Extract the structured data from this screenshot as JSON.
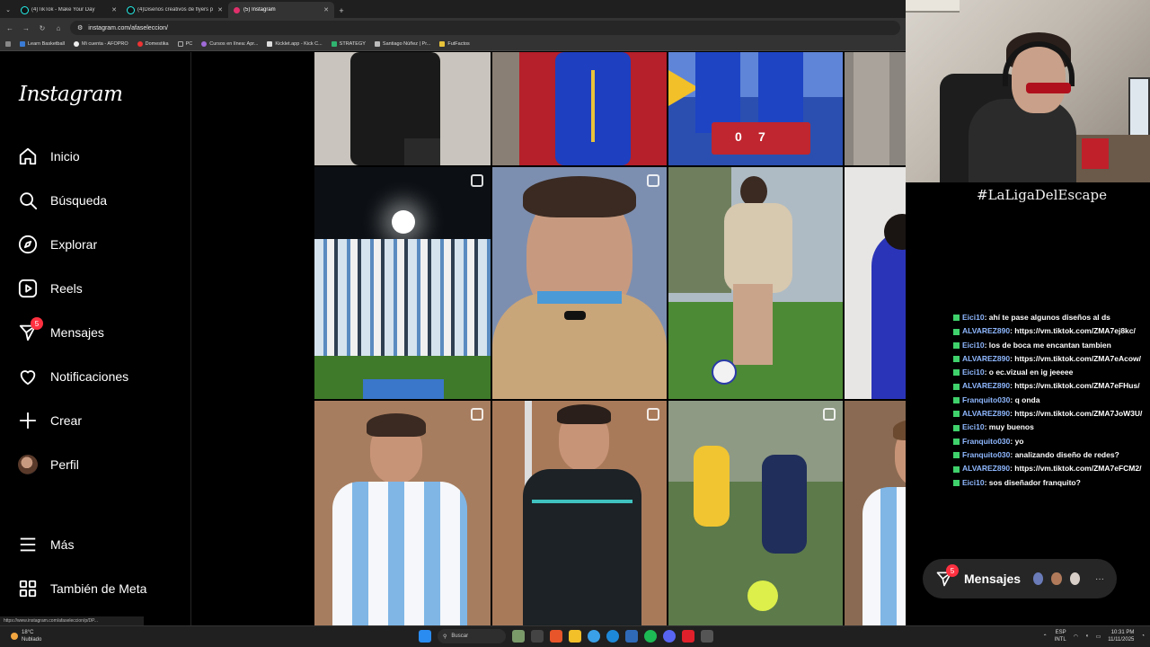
{
  "browser": {
    "tabs": [
      {
        "title": "(4)TikTok - Make Your Day",
        "active": false,
        "icon": "tiktok-icon"
      },
      {
        "title": "(4)Diseños creativos de flyers p",
        "active": false,
        "icon": "tiktok-icon"
      },
      {
        "title": "(5) Instagram",
        "active": true,
        "icon": "instagram-icon"
      }
    ],
    "url": "instagram.com/afaseleccion/",
    "bookmarks": [
      "Learn Basketball",
      "Mi cuenta - AFOPRO",
      "Domestika",
      "PC",
      "Cursos en línea: Apr...",
      "Kicklet.app - Kick C...",
      "STRATEGY",
      "Santiago Núñez | Pr...",
      "FutFactos"
    ],
    "status_url": "https://www.instagram.com/afaseleccion/p/DP..."
  },
  "instagram": {
    "logo": "Instagram",
    "nav": [
      {
        "label": "Inicio",
        "icon": "home-icon"
      },
      {
        "label": "Búsqueda",
        "icon": "search-icon"
      },
      {
        "label": "Explorar",
        "icon": "compass-icon"
      },
      {
        "label": "Reels",
        "icon": "reels-icon"
      },
      {
        "label": "Mensajes",
        "icon": "messenger-icon",
        "badge": "5"
      },
      {
        "label": "Notificaciones",
        "icon": "heart-icon"
      },
      {
        "label": "Crear",
        "icon": "plus-icon"
      },
      {
        "label": "Perfil",
        "icon": "profile-avatar"
      }
    ],
    "more": "Más",
    "meta": "También de Meta",
    "score": {
      "home": "0",
      "away": "7"
    }
  },
  "stream": {
    "tag": "#LaLigaDelEscape",
    "chat": [
      {
        "user": "Eici10",
        "text": ": ahí te pase algunos diseños al ds"
      },
      {
        "user": "ALVAREZ890",
        "text": ": https://vm.tiktok.com/ZMA7ej8kc/"
      },
      {
        "user": "Eici10",
        "text": ": los de boca me encantan tambien"
      },
      {
        "user": "ALVAREZ890",
        "text": ": https://vm.tiktok.com/ZMA7eAcow/"
      },
      {
        "user": "Eici10",
        "text": ": o ec.vizual en ig jeeeee"
      },
      {
        "user": "ALVAREZ890",
        "text": ": https://vm.tiktok.com/ZMA7eFHus/"
      },
      {
        "user": "Franquito030",
        "text": ": q onda"
      },
      {
        "user": "ALVAREZ890",
        "text": ": https://vm.tiktok.com/ZMA7JoW3U/"
      },
      {
        "user": "Eici10",
        "text": ": muy buenos"
      },
      {
        "user": "Franquito030",
        "text": ": yo"
      },
      {
        "user": "Franquito030",
        "text": ": analizando diseño de redes?"
      },
      {
        "user": "ALVAREZ890",
        "text": ": https://vm.tiktok.com/ZMA7eFCM2/"
      },
      {
        "user": "Eici10",
        "text": ": sos diseñador franquito?"
      }
    ]
  },
  "messages_pill": {
    "label": "Mensajes",
    "badge": "5"
  },
  "taskbar": {
    "weather_temp": "18°C",
    "weather_desc": "Nublado",
    "search": "Buscar",
    "lang_top": "ESP",
    "lang_bottom": "INTL",
    "time": "10:31 PM",
    "date": "11/11/2025"
  }
}
